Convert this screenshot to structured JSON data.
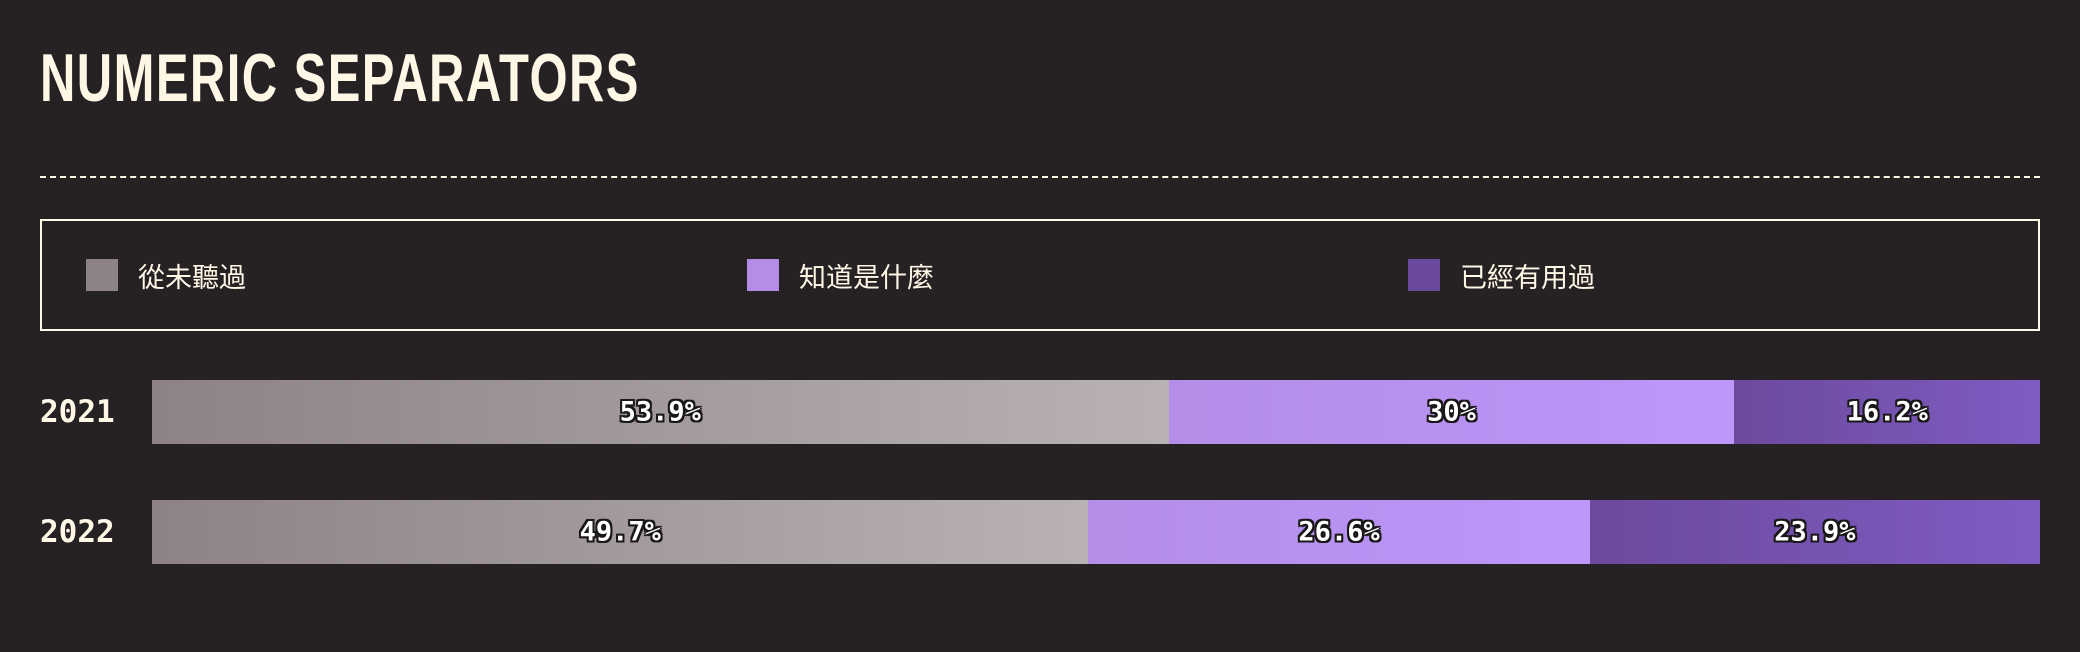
{
  "chart_data": {
    "type": "bar",
    "orientation": "horizontal",
    "stacked": true,
    "normalized": true,
    "title": "NUMERIC SEPARATORS",
    "categories": [
      "2021",
      "2022"
    ],
    "series": [
      {
        "name": "從未聽過",
        "values": [
          53.9,
          49.7
        ],
        "labels": [
          "53.9%",
          "49.7%"
        ],
        "color": "#8c8287",
        "color_end": "#b9b1b4"
      },
      {
        "name": "知道是什麼",
        "values": [
          30,
          26.6
        ],
        "labels": [
          "30%",
          "26.6%"
        ],
        "color": "#b38de8",
        "color_end": "#bd97fa"
      },
      {
        "name": "已經有用過",
        "values": [
          16.2,
          23.9
        ],
        "labels": [
          "16.2%",
          "23.9%"
        ],
        "color": "#6b4a9e",
        "color_end": "#7f5cc2"
      }
    ],
    "xlim": [
      0,
      100
    ],
    "grid": false,
    "legend_position": "top"
  },
  "colors": {
    "background": "#262224",
    "text": "#fff7e6",
    "label_outline": "#1a1718"
  }
}
